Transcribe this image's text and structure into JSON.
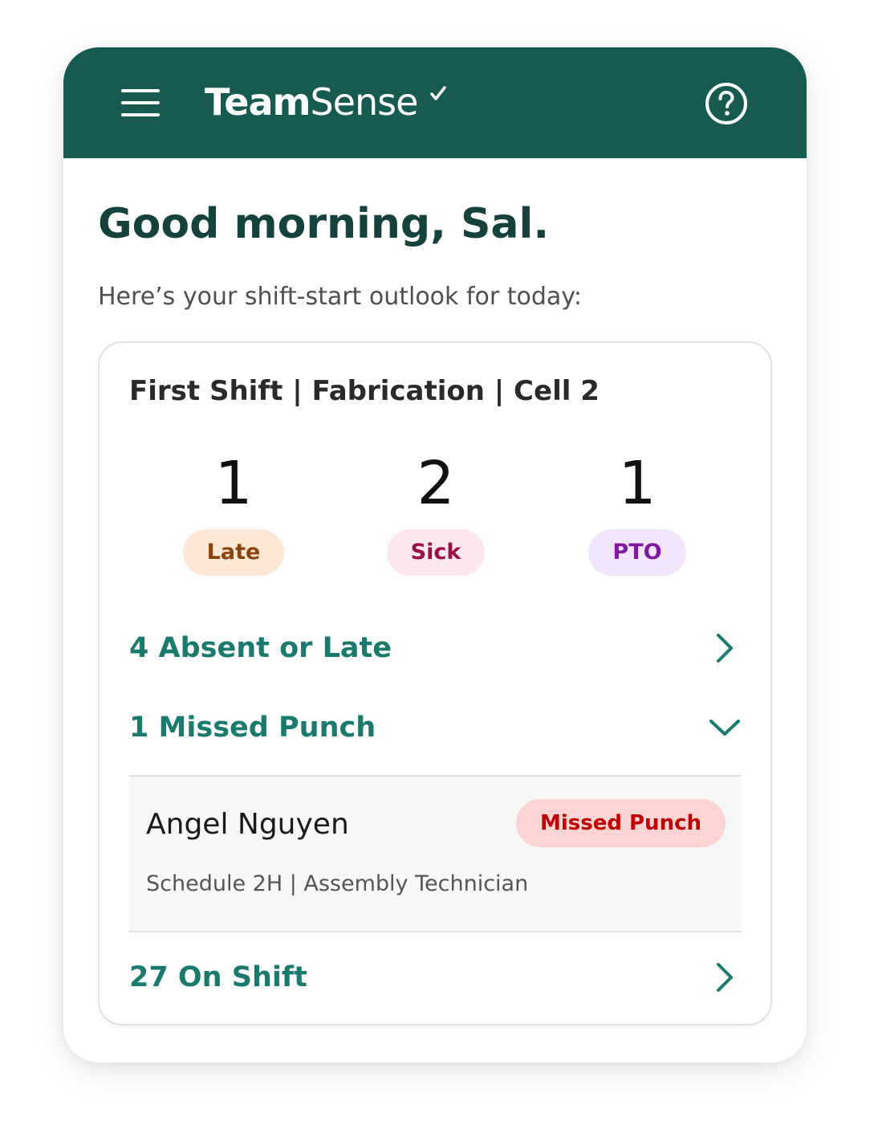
{
  "app": {
    "brand_primary": "Team",
    "brand_secondary": "Sense",
    "colors": {
      "header": "#175a52",
      "accent": "#1b7a6e",
      "heading": "#16423d"
    }
  },
  "header": {
    "menu_icon": "hamburger-menu-icon",
    "help_icon": "question-circle-icon"
  },
  "greeting": "Good morning, Sal.",
  "subtitle": "Here’s your shift-start outlook for today:",
  "shift": {
    "title": "First Shift | Fabrication | Cell 2",
    "stats": [
      {
        "count": "1",
        "label": "Late",
        "color": "#8a4410",
        "bg": "#fde8d6"
      },
      {
        "count": "2",
        "label": "Sick",
        "color": "#9c0f48",
        "bg": "#fde8f0"
      },
      {
        "count": "1",
        "label": "PTO",
        "color": "#7d1a9e",
        "bg": "#f3e5fb"
      }
    ],
    "rows": [
      {
        "label": "4 Absent or Late",
        "icon": "chevron-right-icon"
      },
      {
        "label": "1 Missed Punch",
        "icon": "chevron-down-icon"
      },
      {
        "label": "27 On Shift",
        "icon": "chevron-right-icon"
      }
    ],
    "missed_punch_list": [
      {
        "name": "Angel Nguyen",
        "status": "Missed Punch",
        "detail": "Schedule 2H | Assembly Technician"
      }
    ]
  }
}
